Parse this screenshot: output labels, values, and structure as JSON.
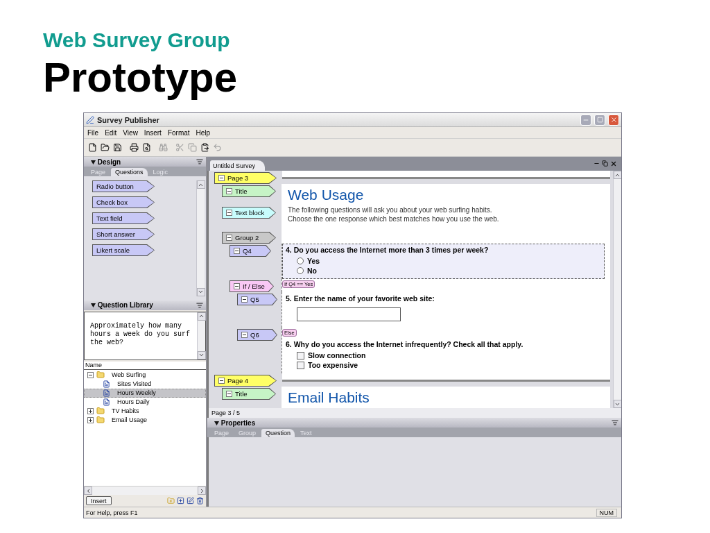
{
  "slide": {
    "subtitle": "Web Survey Group",
    "title": "Prototype"
  },
  "window": {
    "title": "Survey Publisher"
  },
  "menu": [
    "File",
    "Edit",
    "View",
    "Insert",
    "Format",
    "Help"
  ],
  "toolbar": [
    {
      "kind": "new",
      "disabled": false
    },
    {
      "kind": "open",
      "disabled": false
    },
    {
      "kind": "save",
      "disabled": false
    },
    {
      "kind": "print",
      "disabled": false
    },
    {
      "kind": "preview",
      "disabled": false
    },
    {
      "kind": "find",
      "disabled": true
    },
    {
      "kind": "cut",
      "disabled": true
    },
    {
      "kind": "copy",
      "disabled": true
    },
    {
      "kind": "paste",
      "disabled": false
    },
    {
      "kind": "undo",
      "disabled": true
    }
  ],
  "design": {
    "title": "Design",
    "tabs": [
      {
        "label": "Page",
        "selected": false
      },
      {
        "label": "Questions",
        "selected": true
      },
      {
        "label": "Logic",
        "selected": false
      }
    ],
    "items": [
      "Radio button",
      "Check box",
      "Text field",
      "Short answer",
      "Likert scale"
    ]
  },
  "library": {
    "title": "Question Library",
    "preview": "Approximately how many hours a week do you surf the web?",
    "column": "Name",
    "tree": [
      {
        "label": "Web Surfing",
        "kind": "folder",
        "expanded": true,
        "selected": false,
        "children": [
          {
            "label": "Sites Visited",
            "kind": "question",
            "selected": false
          },
          {
            "label": "Hours Weekly",
            "kind": "question",
            "selected": true
          },
          {
            "label": "Hours Daily",
            "kind": "question",
            "selected": false
          }
        ]
      },
      {
        "label": "TV Habits",
        "kind": "folder",
        "expanded": false,
        "selected": false
      },
      {
        "label": "Email Usage",
        "kind": "folder",
        "expanded": false,
        "selected": false
      }
    ],
    "insert_button": "Insert"
  },
  "document": {
    "tab": "Untitled Survey",
    "nodes": [
      {
        "kind": "page",
        "label": "Page 3",
        "expanded": true,
        "children": [
          {
            "kind": "title",
            "label": "Title",
            "expanded": true,
            "heading": "Web Usage"
          },
          {
            "kind": "text",
            "label": "Text block",
            "expanded": true,
            "lines": [
              "The following questions will ask you about your web surfing habits.",
              "Choose the one response which best matches how you use the web."
            ]
          },
          {
            "kind": "group",
            "label": "Group 2",
            "expanded": true,
            "children": [
              {
                "kind": "radio",
                "label": "Q4",
                "expanded": true,
                "selected": true,
                "question": "4. Do you access the Internet more than 3 times per week?",
                "options": [
                  {
                    "label": "Yes",
                    "selected": false
                  },
                  {
                    "label": "No",
                    "selected": false
                  }
                ]
              },
              {
                "kind": "logic",
                "label": "If / Else",
                "expanded": true,
                "tag": "If Q4 == Yes",
                "children": [
                  {
                    "kind": "entry",
                    "label": "Q5",
                    "expanded": true,
                    "selected": false,
                    "question": "5. Enter the name of your favorite web site:"
                  },
                  {
                    "kind": "checkbox",
                    "label": "Q6",
                    "expanded": true,
                    "selected": false,
                    "tag": "Else",
                    "question": "6. Why do you access the Internet infrequently? Check all that apply.",
                    "options": [
                      {
                        "label": "Slow connection",
                        "checked": false
                      },
                      {
                        "label": "Too expensive",
                        "checked": false
                      }
                    ]
                  }
                ]
              }
            ]
          }
        ]
      },
      {
        "kind": "page",
        "label": "Page 4",
        "expanded": true,
        "children": [
          {
            "kind": "title",
            "label": "Title",
            "expanded": true,
            "heading": "Email Habits"
          }
        ]
      }
    ],
    "page_indicator": "Page 3 / 5"
  },
  "properties": {
    "title": "Properties",
    "tabs": [
      {
        "label": "Page",
        "selected": false
      },
      {
        "label": "Group",
        "selected": false
      },
      {
        "label": "Question",
        "selected": true
      },
      {
        "label": "Text",
        "selected": false
      }
    ]
  },
  "status_bar": {
    "help": "For Help, press F1",
    "num": "NUM"
  }
}
